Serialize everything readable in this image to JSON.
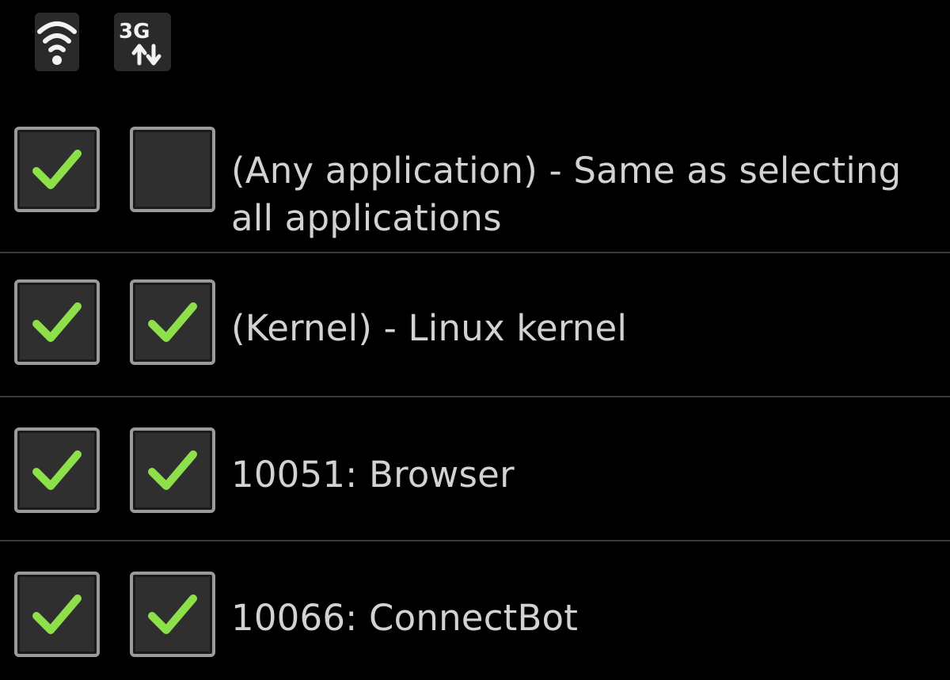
{
  "header": {
    "wifi_icon": "wifi-icon",
    "data_icon": "3g-data-icon",
    "data_icon_text": "3G"
  },
  "colors": {
    "background": "#000000",
    "checkmark": "#8ee04a",
    "text": "#d2d2d2",
    "divider": "#3a3a3a"
  },
  "apps": [
    {
      "label": "(Any application) - Same as selecting all applications",
      "wifi_checked": true,
      "data_checked": false
    },
    {
      "label": "(Kernel) - Linux kernel",
      "wifi_checked": true,
      "data_checked": true
    },
    {
      "label": "10051: Browser",
      "wifi_checked": true,
      "data_checked": true
    },
    {
      "label": "10066: ConnectBot",
      "wifi_checked": true,
      "data_checked": true
    }
  ]
}
